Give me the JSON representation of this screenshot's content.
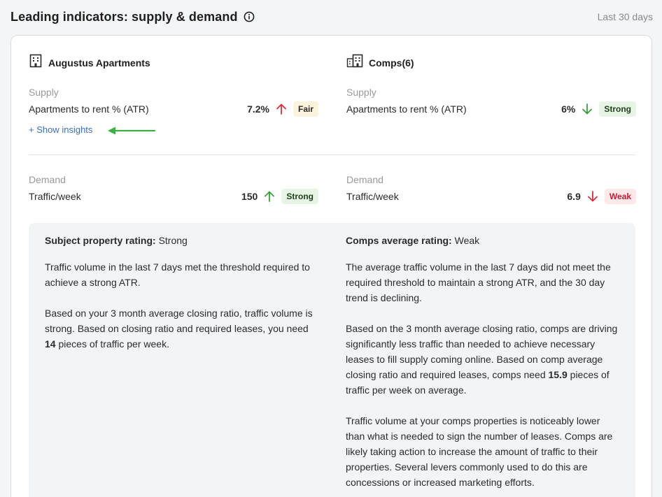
{
  "header": {
    "title": "Leading indicators: supply & demand",
    "range": "Last 30 days"
  },
  "subject": {
    "name": "Augustus Apartments",
    "icon": "building-icon",
    "supply": {
      "label": "Supply",
      "metric": "Apartments to rent % (ATR)",
      "value": "7.2%",
      "trend": "up",
      "trend_color": "#d92d3a",
      "rating": "Fair"
    },
    "show_insights": "+ Show insights",
    "demand": {
      "label": "Demand",
      "metric": "Traffic/week",
      "value": "150",
      "trend": "up",
      "trend_color": "#3aa03a",
      "rating": "Strong"
    }
  },
  "comps": {
    "name": "Comps(6)",
    "icon": "buildings-icon",
    "supply": {
      "label": "Supply",
      "metric": "Apartments to rent % (ATR)",
      "value": "6%",
      "trend": "down",
      "trend_color": "#3aa03a",
      "rating": "Strong"
    },
    "demand": {
      "label": "Demand",
      "metric": "Traffic/week",
      "value": "6.9",
      "trend": "down",
      "trend_color": "#d92d3a",
      "rating": "Weak"
    }
  },
  "insights": {
    "subject": {
      "rating_label": "Subject property rating:",
      "rating_value": "Strong",
      "para1": "Traffic volume in the last 7 days met the threshold required to achieve a strong ATR.",
      "para2_a": "Based on your 3 month average closing ratio, traffic volume is strong. Based on closing ratio and required leases, you need",
      "para2_num": "14",
      "para2_b": "pieces of traffic per week."
    },
    "comps": {
      "rating_label": "Comps average rating:",
      "rating_value": "Weak",
      "para1": "The average traffic volume in the last 7 days did not meet the required threshold to maintain a strong ATR, and the 30 day trend is declining.",
      "para2_a": "Based on the 3 month average closing ratio, comps are driving significantly less traffic than needed to achieve necessary leases to fill supply coming online. Based on comp average closing ratio and required leases, comps need",
      "para2_num": "15.9",
      "para2_b": "pieces of traffic per week on average.",
      "para3": "Traffic volume at your comps properties is noticeably lower than what is needed to sign the number of leases. Comps are likely taking action to increase the amount of traffic to their properties. Several levers commonly used to do this are concessions or increased marketing efforts."
    }
  },
  "colors": {
    "link": "#3b6fb6",
    "annotation_arrow": "#3cb043"
  }
}
